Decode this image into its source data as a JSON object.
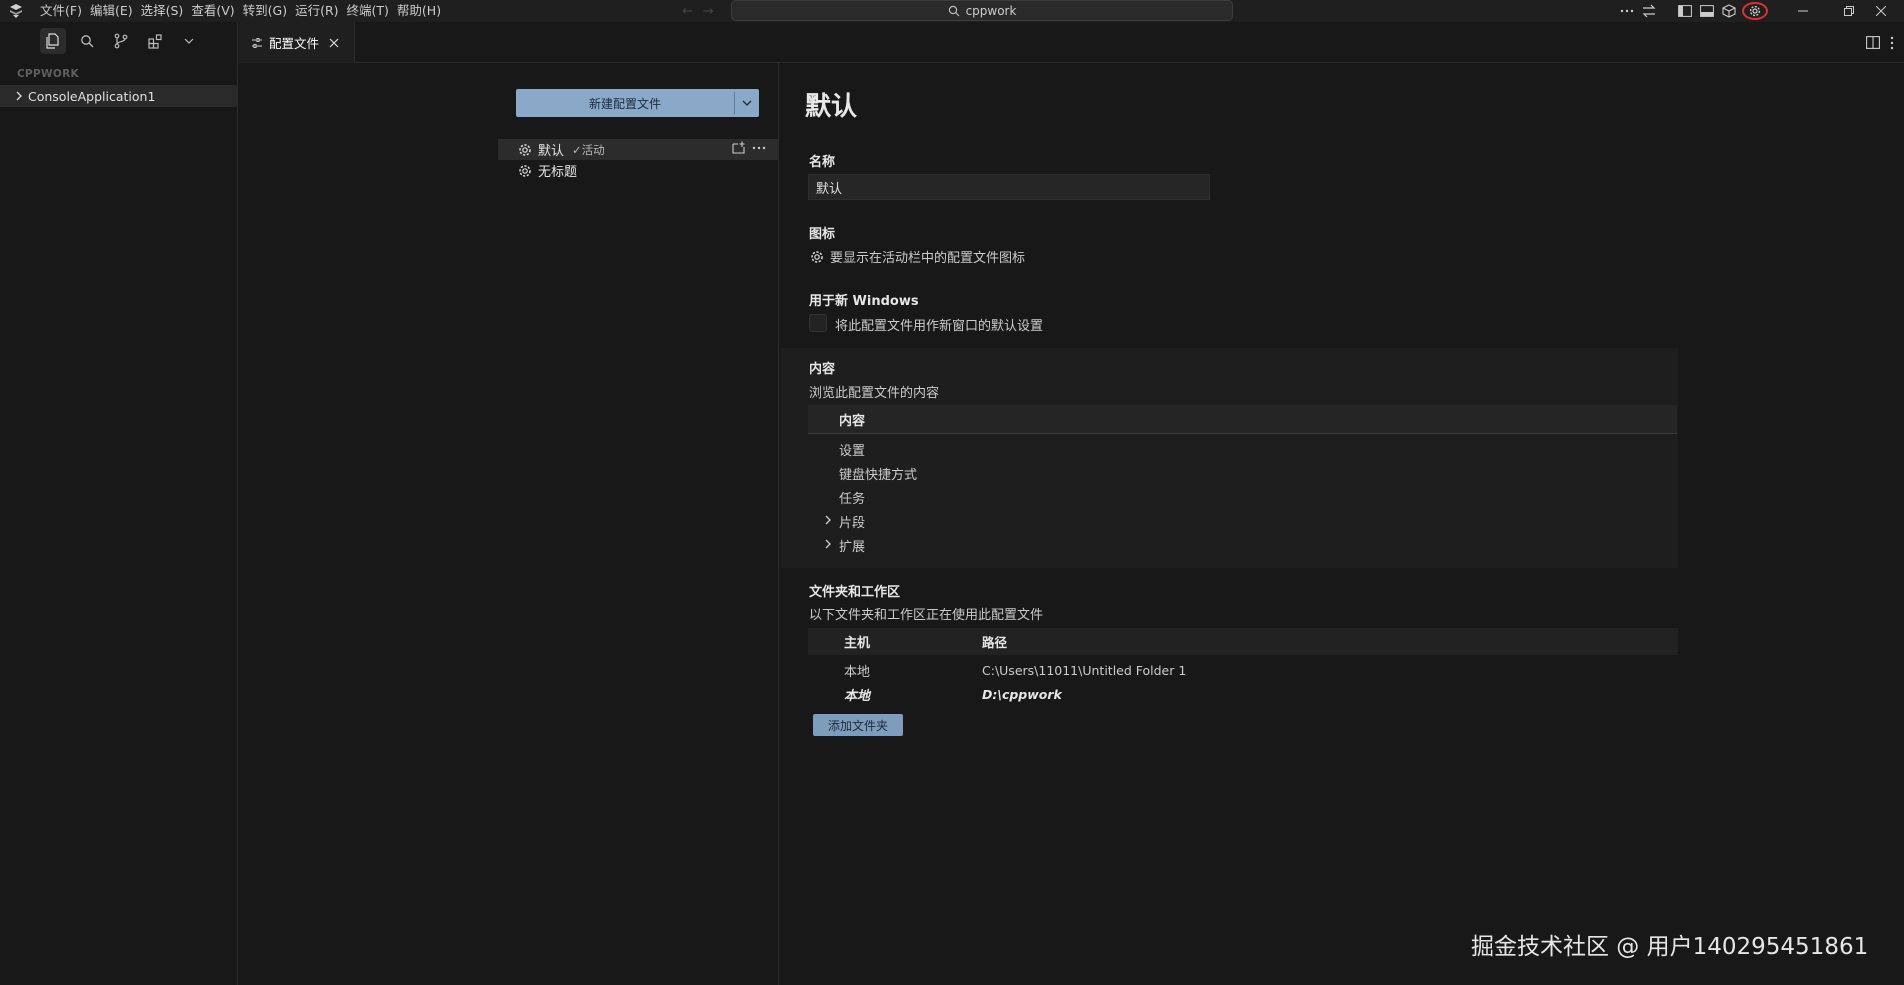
{
  "titlebar": {
    "menu": [
      "文件(F)",
      "编辑(E)",
      "选择(S)",
      "查看(V)",
      "转到(G)",
      "运行(R)",
      "终端(T)",
      "帮助(H)"
    ],
    "search_text": "cppwork",
    "icons": [
      "more-icon",
      "sync-icon",
      "toggle-sidebar-icon",
      "toggle-panel-icon",
      "extension-icon",
      "accounts-gear-icon"
    ]
  },
  "sidebar": {
    "section_header": "CPPWORK",
    "tree_item": "ConsoleApplication1"
  },
  "tab": {
    "label": "配置文件"
  },
  "profiles": {
    "new_button": "新建配置文件",
    "list": [
      {
        "name": "默认",
        "status": "✓活动"
      },
      {
        "name": "无标题"
      }
    ]
  },
  "detail": {
    "title": "默认",
    "name_label": "名称",
    "name_value": "默认",
    "icon_label": "图标",
    "icon_text": "要显示在活动栏中的配置文件图标",
    "new_window_label": "用于新 Windows",
    "new_window_checkbox": "将此配置文件用作新窗口的默认设置",
    "contents_label": "内容",
    "contents_desc": "浏览此配置文件的内容",
    "contents_header": "内容",
    "contents_items": [
      {
        "label": "设置",
        "expandable": false
      },
      {
        "label": "键盘快捷方式",
        "expandable": false
      },
      {
        "label": "任务",
        "expandable": false
      },
      {
        "label": "片段",
        "expandable": true
      },
      {
        "label": "扩展",
        "expandable": true
      }
    ],
    "folders_label": "文件夹和工作区",
    "folders_desc": "以下文件夹和工作区正在使用此配置文件",
    "folders_col_host": "主机",
    "folders_col_path": "路径",
    "folders_rows": [
      {
        "host": "本地",
        "path": "C:\\Users\\11011\\Untitled Folder 1"
      },
      {
        "host": "本地",
        "path": "D:\\cppwork"
      }
    ],
    "add_folder_button": "添加文件夹"
  },
  "watermark": "掘金技术社区 @ 用户140295451861",
  "colors": {
    "accent_button": "#8aa8c8",
    "highlight_ring": "#e0302c",
    "background": "#181818"
  }
}
